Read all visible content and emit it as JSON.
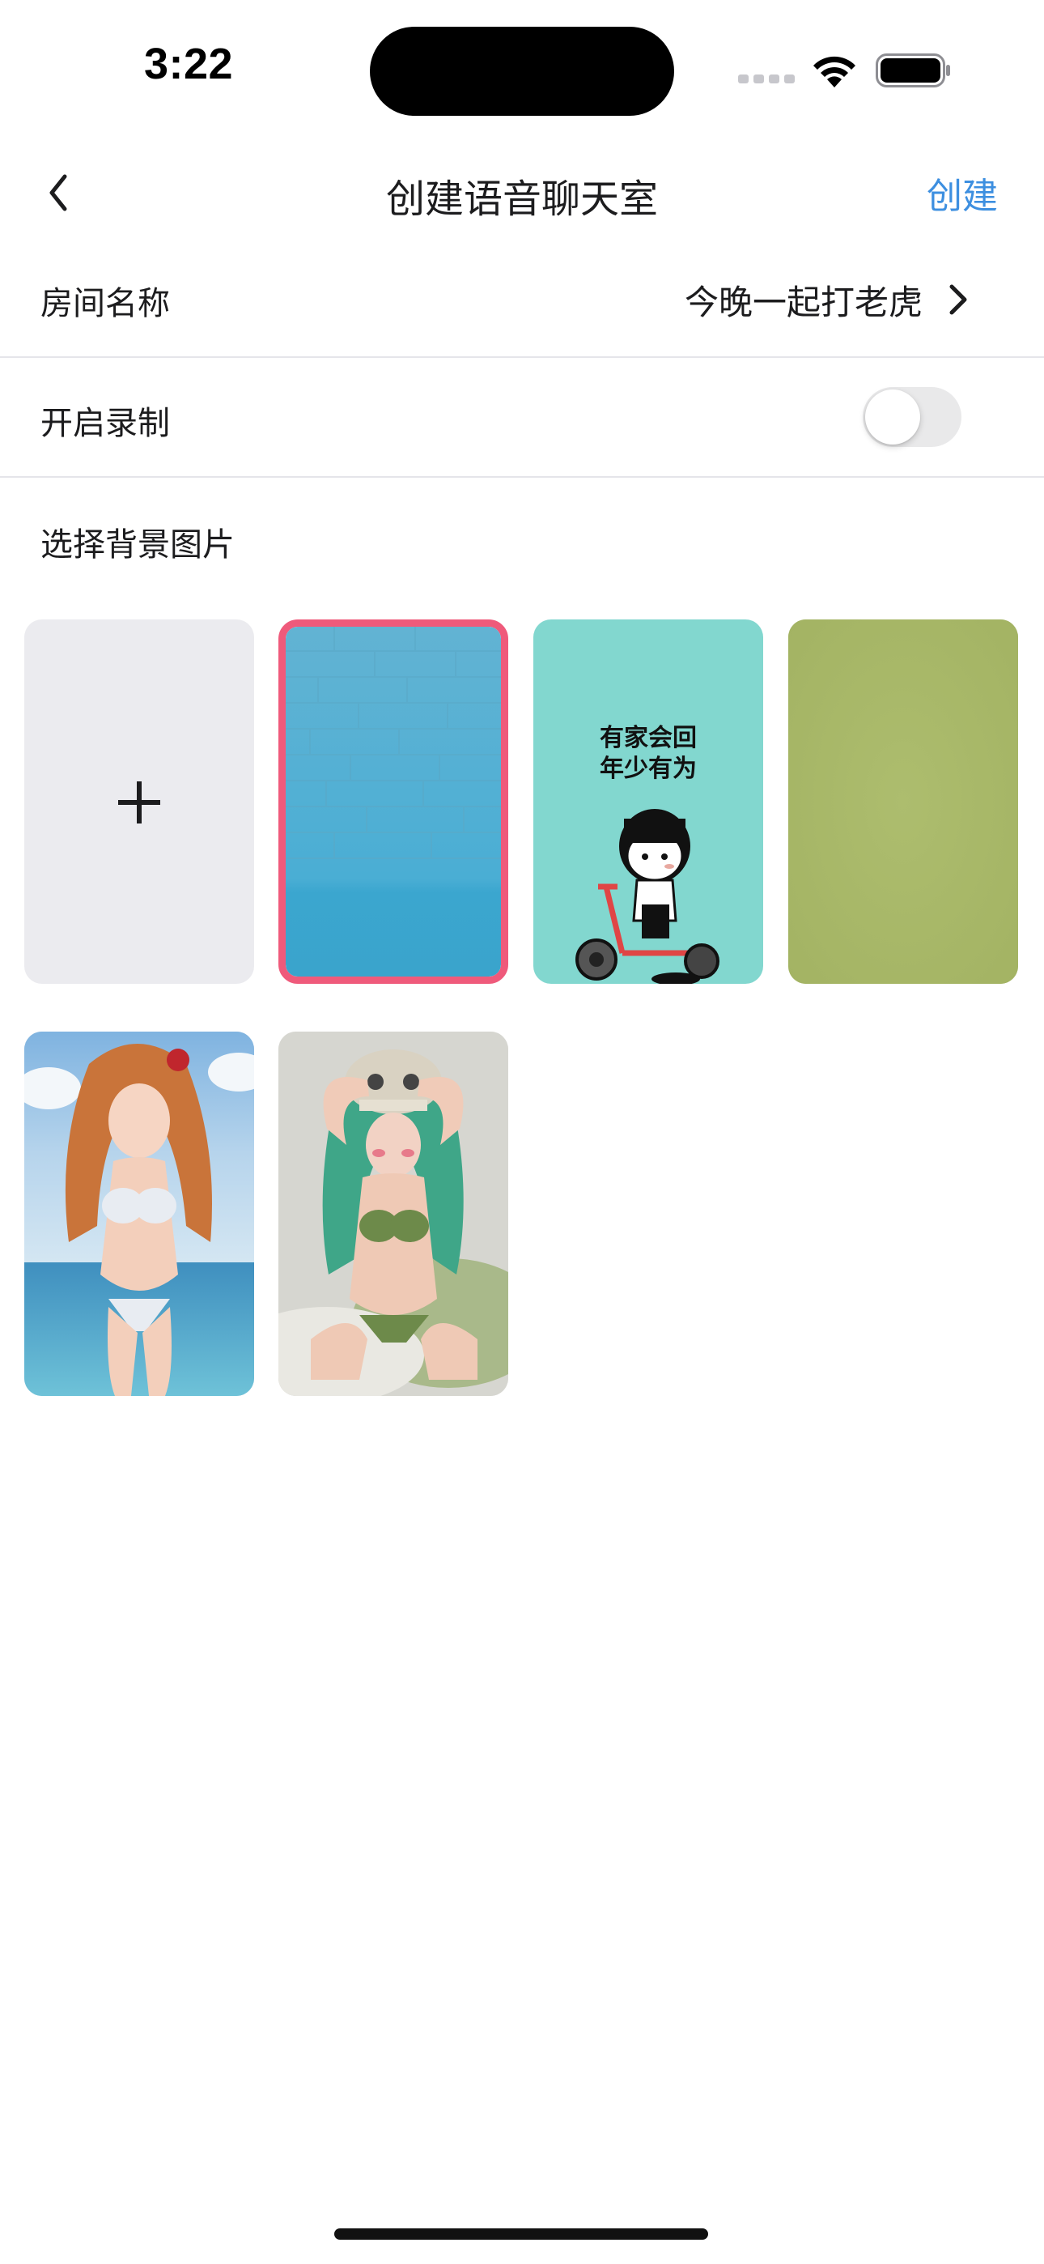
{
  "status_bar": {
    "time": "3:22"
  },
  "nav": {
    "title": "创建语音聊天室",
    "create_label": "创建"
  },
  "room_name": {
    "label": "房间名称",
    "value": "今晚一起打老虎"
  },
  "recording": {
    "label": "开启录制",
    "enabled": false
  },
  "background": {
    "section_label": "选择背景图片",
    "selected_index": 1,
    "tiles": [
      {
        "kind": "add",
        "icon": "plus-icon"
      },
      {
        "kind": "image",
        "desc": "blue-brick-wall"
      },
      {
        "kind": "image",
        "desc": "teal-meme",
        "lines": [
          "有家会回",
          "年少有为"
        ]
      },
      {
        "kind": "image",
        "desc": "olive-green-texture"
      },
      {
        "kind": "image",
        "desc": "orange-hair-girl-beach"
      },
      {
        "kind": "image",
        "desc": "green-hair-girl-skull-hat"
      }
    ]
  },
  "colors": {
    "accent": "#3d8fe0",
    "selected_border": "#ef5a7b",
    "divider": "#e5e5ea",
    "add_tile_bg": "#ebebef",
    "toggle_off": "#e9e9ea"
  }
}
